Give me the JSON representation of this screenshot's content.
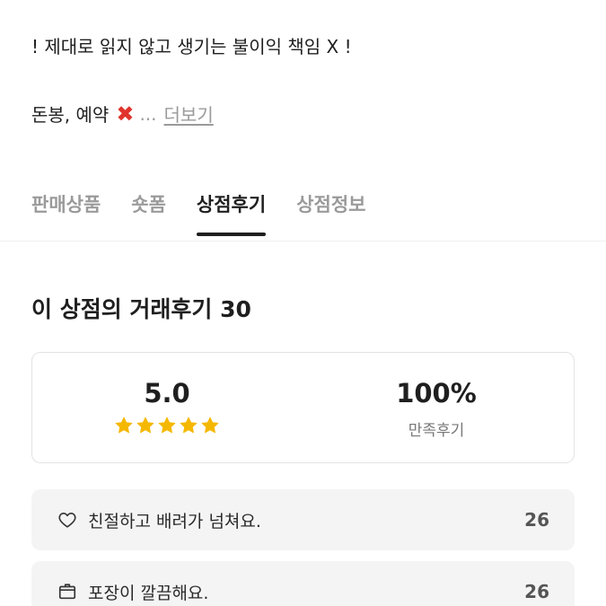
{
  "description": {
    "line1": "! 제대로 읽지 않고 생기는 불이익 책임 X !",
    "line2_prefix": "돈봉, 예약",
    "line2_mark": "✖",
    "ellipsis": "...",
    "more_label": "더보기"
  },
  "tabs": [
    {
      "label": "판매상품",
      "active": false
    },
    {
      "label": "숏폼",
      "active": false
    },
    {
      "label": "상점후기",
      "active": true
    },
    {
      "label": "상점정보",
      "active": false
    }
  ],
  "reviews": {
    "title": "이 상점의 거래후기 30",
    "rating": "5.0",
    "rating_stars": 5,
    "star_color": "#f5b800",
    "satisfaction": "100%",
    "satisfaction_label": "만족후기",
    "items": [
      {
        "icon": "heart-icon",
        "text": "친절하고 배려가 넘쳐요.",
        "count": "26"
      },
      {
        "icon": "box-icon",
        "text": "포장이 깔끔해요.",
        "count": "26"
      }
    ]
  }
}
